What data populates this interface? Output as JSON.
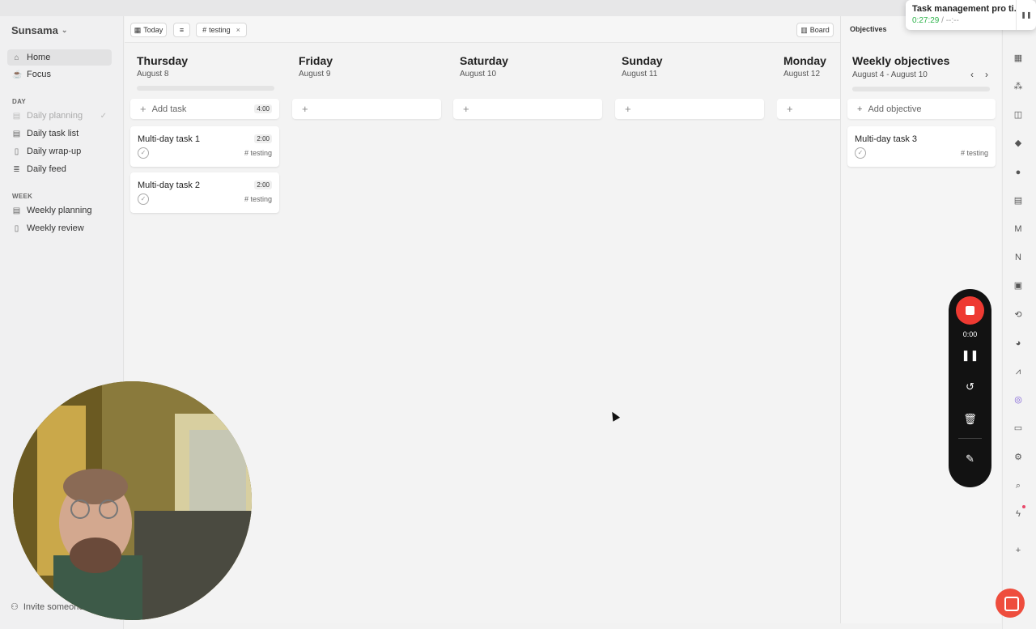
{
  "sidebar": {
    "brand": "Sunsama",
    "items": [
      {
        "label": "Home",
        "icon": "home-icon"
      },
      {
        "label": "Focus",
        "icon": "cup-icon"
      }
    ],
    "day_section": "DAY",
    "day_items": [
      {
        "label": "Daily planning",
        "icon": "clipboard-icon"
      },
      {
        "label": "Daily task list",
        "icon": "clipboard-icon"
      },
      {
        "label": "Daily wrap-up",
        "icon": "book-icon"
      },
      {
        "label": "Daily feed",
        "icon": "list-icon"
      }
    ],
    "week_section": "WEEK",
    "week_items": [
      {
        "label": "Weekly planning",
        "icon": "clipboard-icon"
      },
      {
        "label": "Weekly review",
        "icon": "book-icon"
      }
    ],
    "invite": "Invite someone"
  },
  "toolbar": {
    "today": "Today",
    "filter_tag": "testing",
    "board": "Board"
  },
  "days": [
    {
      "name": "Thursday",
      "date": "August 8",
      "add_label": "Add task",
      "total": "4:00"
    },
    {
      "name": "Friday",
      "date": "August 9"
    },
    {
      "name": "Saturday",
      "date": "August 10"
    },
    {
      "name": "Sunday",
      "date": "August 11"
    },
    {
      "name": "Monday",
      "date": "August 12"
    }
  ],
  "tasks": [
    {
      "title": "Multi-day task 1",
      "duration": "2:00",
      "tag": "testing"
    },
    {
      "title": "Multi-day task 2",
      "duration": "2:00",
      "tag": "testing"
    }
  ],
  "objectives": {
    "header": "Objectives",
    "title": "Weekly objectives",
    "range": "August 4 - August 10",
    "add_label": "Add objective",
    "items": [
      {
        "title": "Multi-day task 3",
        "tag": "testing"
      }
    ]
  },
  "recorder": {
    "elapsed": "0:00"
  },
  "notification": {
    "title": "Task management pro ti...",
    "elapsed": "0:27:29",
    "separator": " / ",
    "remaining": "--:--"
  }
}
